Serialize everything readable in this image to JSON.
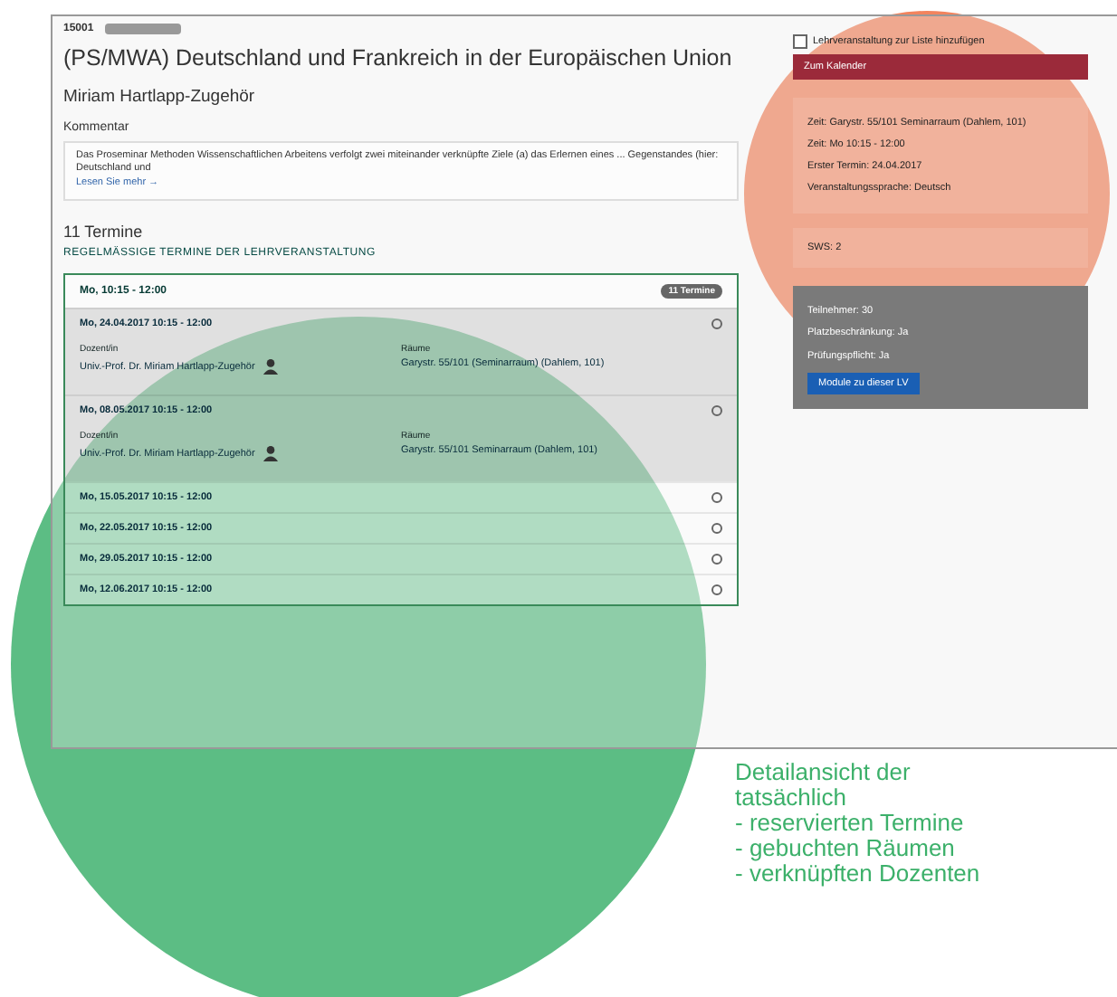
{
  "course": {
    "number": "15001",
    "title": "(PS/MWA) Deutschland und Frankreich in der Europäischen Union",
    "lecturer": "Miriam Hartlapp-Zugehör",
    "comment_label": "Kommentar",
    "comment": "Das Proseminar Methoden Wissenschaftlichen Arbeitens verfolgt zwei miteinander verknüpfte Ziele (a) das Erlernen eines ... Gegenstandes (hier: Deutschland und",
    "read_more": "Lesen Sie mehr →"
  },
  "schedule": {
    "count": "11 Termine",
    "heading": "REGELMÄSSIGE TERMINE DER LEHRVERANSTALTUNG",
    "group": "Mo, 10:15 - 12:00",
    "group_badge": "11 Termine",
    "dates": [
      {
        "date": "Mo, 24.04.2017 10:15 - 12:00",
        "expanded": true,
        "lecturer_label": "Dozent/in",
        "lecturer": "Univ.-Prof. Dr. Miriam Hartlapp-Zugehör",
        "room_label": "Räume",
        "room": "Garystr. 55/101 (Seminarraum) (Dahlem, 101)"
      },
      {
        "date": "Mo, 08.05.2017 10:15 - 12:00",
        "expanded": true,
        "lecturer_label": "Dozent/in",
        "lecturer": "Univ.-Prof. Dr. Miriam Hartlapp-Zugehör",
        "room_label": "Räume",
        "room": "Garystr. 55/101 Seminarraum (Dahlem, 101)"
      },
      {
        "date": "Mo, 15.05.2017 10:15 - 12:00",
        "expanded": false
      },
      {
        "date": "Mo, 22.05.2017 10:15 - 12:00",
        "expanded": false
      },
      {
        "date": "Mo, 29.05.2017 10:15 - 12:00",
        "expanded": false
      },
      {
        "date": "Mo, 12.06.2017 10:15 - 12:00",
        "expanded": false
      }
    ]
  },
  "sidebar": {
    "checkbox": {
      "label": "Lehrveranstaltung zur Liste hinzufügen",
      "checked": false
    },
    "calendar_button": "Zum Kalender",
    "details": [
      "Zeit: Garystr. 55/101 Seminarraum (Dahlem, 101)",
      "Zeit: Mo 10:15 - 12:00",
      "Erster Termin: 24.04.2017",
      "Veranstaltungssprache: Deutsch"
    ],
    "sws": "SWS: 2",
    "info": [
      "Teilnehmer: 30",
      "Platzbeschränkung: Ja",
      "Prüfungspflicht: Ja"
    ],
    "modules_button": "Module zu dieser LV"
  },
  "annotation": [
    "Detailansicht der",
    "tatsächlich",
    "- reservierten Termine",
    "- gebuchten Räumen",
    "- verknüpften Dozenten"
  ]
}
